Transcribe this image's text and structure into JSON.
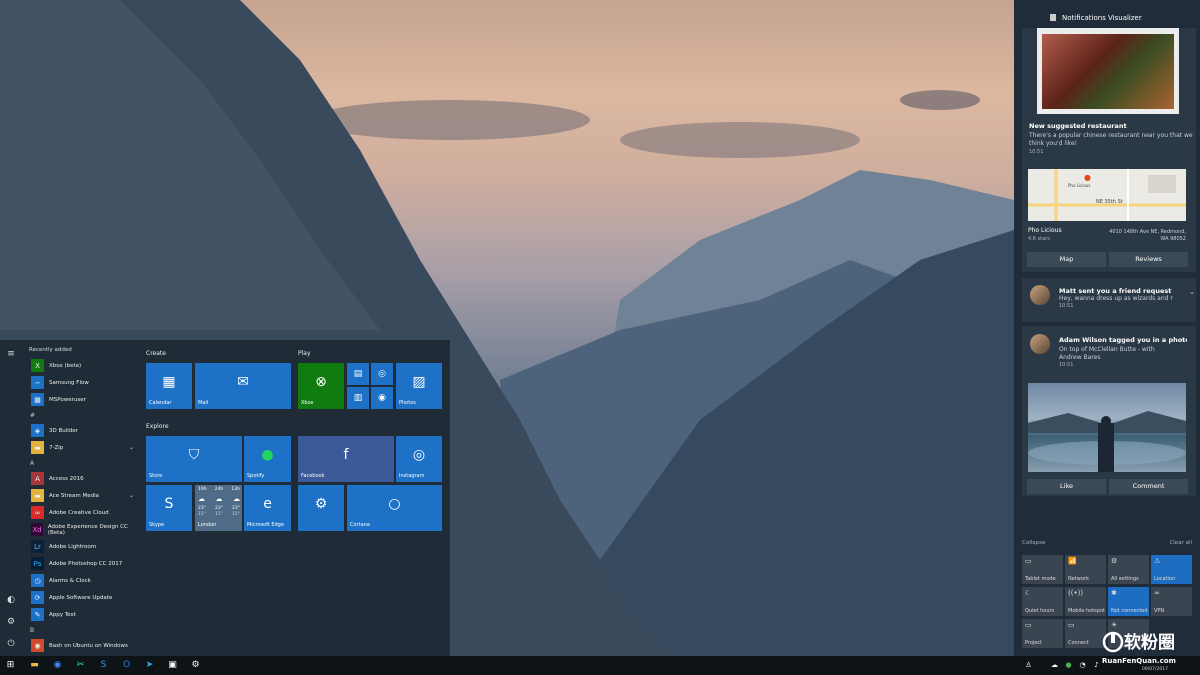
{
  "start": {
    "recently_added_label": "Recently added",
    "recent": [
      "Xbox (beta)",
      "Samsung Flow",
      "MSPoweruser"
    ],
    "groups": [
      {
        "letter": "#",
        "apps": [
          "3D Builder",
          "7-Zip"
        ]
      },
      {
        "letter": "A",
        "apps": [
          "Access 2016",
          "Ace Stream Media",
          "Adobe Creative Cloud",
          "Adobe Experience Design CC (Beta)",
          "Adobe Lightroom",
          "Adobe Photoshop CC 2017",
          "Alarms & Clock",
          "Apple Software Update",
          "Appy Text"
        ]
      },
      {
        "letter": "B",
        "apps": [
          "Bash on Ubuntu on Windows"
        ]
      }
    ],
    "sections": {
      "create": "Create",
      "play": "Play",
      "explore": "Explore"
    },
    "tiles": {
      "calendar": "Calendar",
      "mail": "Mail",
      "xbox": "Xbox",
      "photos": "Photos",
      "store": "Store",
      "spotify": "Spotify",
      "facebook": "Facebook",
      "instagram": "Instagram",
      "skype": "Skype",
      "london": "London",
      "edge": "Microsoft Edge",
      "cortana": "Cortana"
    },
    "weather": {
      "days": [
        "19h",
        "24h",
        "13h"
      ],
      "temps": [
        "23°",
        "23°",
        "23°"
      ],
      "lows": [
        "15°",
        "15°",
        "15°"
      ]
    }
  },
  "action_center": {
    "title": "Notifications Visualizer",
    "n1": {
      "title": "New suggested restaurant",
      "body": "There's a popular chinese restaurant near you that we think you'd like!",
      "time": "10:51"
    },
    "map": {
      "place": "Pho Licious",
      "rating": "4.6 stars",
      "address": "4010 148th Ave NE, Redmond, WA 98052",
      "street": "NE 35th St",
      "marker": "Pho Licious",
      "btn_map": "Map",
      "btn_reviews": "Reviews"
    },
    "n2": {
      "title": "Matt sent you a friend request",
      "body": "Hey, wanna dress up as wizards and r",
      "time": "10:51"
    },
    "n3": {
      "title": "Adam Wilson tagged you in a photo",
      "body": "On top of McClellan Butte - with Andrew Bares",
      "time": "10:51",
      "btn_like": "Like",
      "btn_comment": "Comment"
    },
    "collapse": "Collapse",
    "clear_all": "Clear all",
    "quick_actions": [
      {
        "label": "Tablet mode",
        "icon": "▭",
        "on": false
      },
      {
        "label": "Network",
        "icon": "📶",
        "on": false
      },
      {
        "label": "All settings",
        "icon": "⚙",
        "on": false
      },
      {
        "label": "Location",
        "icon": "⚠",
        "on": true
      },
      {
        "label": "Quiet hours",
        "icon": "☾",
        "on": false
      },
      {
        "label": "Mobile hotspot",
        "icon": "((•))",
        "on": false
      },
      {
        "label": "Not connected",
        "icon": "✱",
        "on": true
      },
      {
        "label": "VPN",
        "icon": "∞",
        "on": false
      },
      {
        "label": "Project",
        "icon": "▭",
        "on": false
      },
      {
        "label": "Connect",
        "icon": "▭",
        "on": false
      },
      {
        "label": "",
        "icon": "☀",
        "on": false
      }
    ]
  },
  "taskbar": {
    "date": "09/07/2017"
  },
  "watermark": {
    "name": "软粉圈",
    "site": "RuanFenQuan.com"
  }
}
